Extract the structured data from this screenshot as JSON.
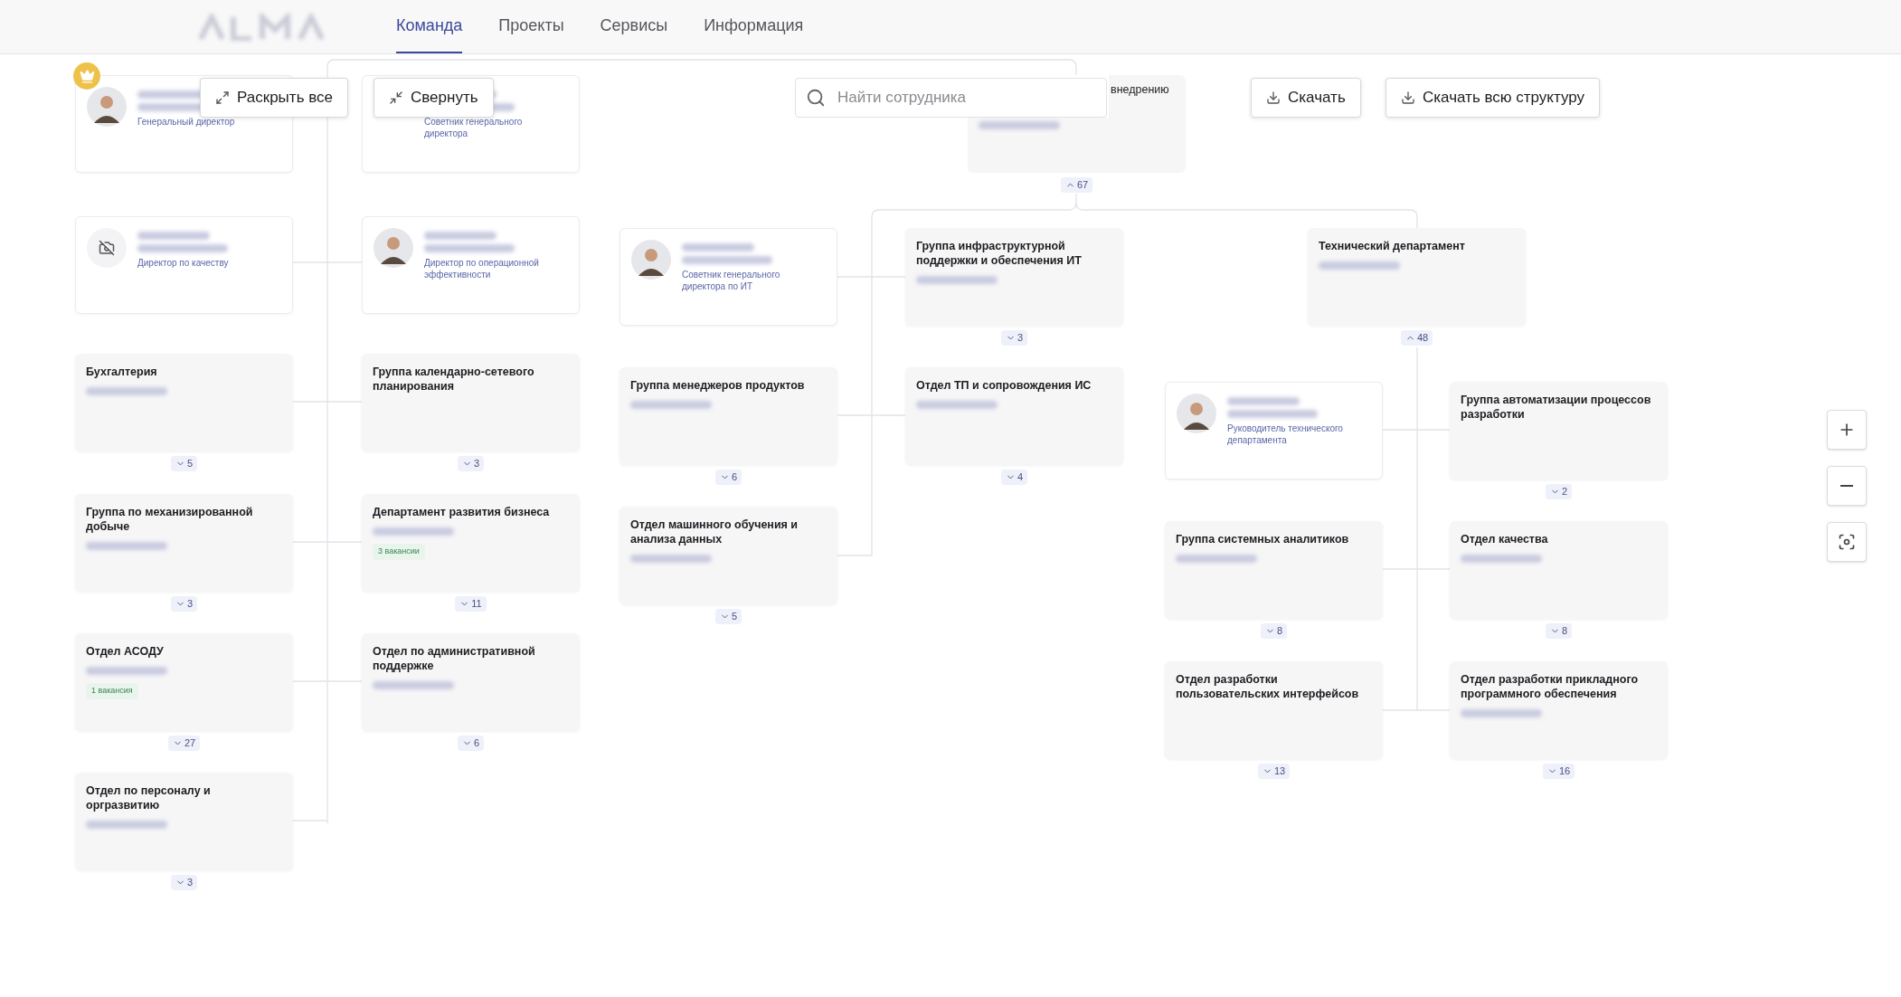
{
  "nav": {
    "tabs": [
      {
        "label": "Команда",
        "selected": true
      },
      {
        "label": "Проекты",
        "selected": false
      },
      {
        "label": "Сервисы",
        "selected": false
      },
      {
        "label": "Информация",
        "selected": false
      }
    ]
  },
  "toolbar": {
    "expand_all": "Раскрыть все",
    "collapse": "Свернуть",
    "search": {
      "placeholder": "Найти сотрудника"
    },
    "download": "Скачать",
    "download_all": "Скачать всю структуру"
  },
  "cards": [
    {
      "kind": "person",
      "role": "Генеральный директор",
      "has_photo": true,
      "crown": true
    },
    {
      "kind": "person",
      "role": "Директор по качеству",
      "has_photo": false,
      "crown": false
    },
    {
      "kind": "department",
      "title": "Бухгалтерия",
      "head_blurred": true,
      "count": "5",
      "expanded": false
    },
    {
      "kind": "department",
      "title": "Группа по механизированной добыче",
      "head_blurred": true,
      "count": "3",
      "expanded": false
    },
    {
      "kind": "department",
      "title": "Отдел АСОДУ",
      "head_blurred": true,
      "vacancy": "1 вакансия",
      "count": "27",
      "expanded": false
    },
    {
      "kind": "department",
      "title": "Отдел по персоналу и оргразвитию",
      "head_blurred": true,
      "count": "3",
      "expanded": false
    },
    {
      "kind": "person",
      "role": "Советник генерального директора",
      "crown": false
    },
    {
      "kind": "person",
      "role": "Директор по операционной эффективности",
      "has_photo": true,
      "crown": false
    },
    {
      "kind": "department",
      "title": "Группа календарно-сетевого планирования",
      "head_blurred": false,
      "count": "3",
      "expanded": false
    },
    {
      "kind": "department",
      "title": "Департамент развития бизнеса",
      "head_blurred": true,
      "vacancy": "3 вакансии",
      "count": "11",
      "expanded": false
    },
    {
      "kind": "department",
      "title": "Отдел по административной поддержке",
      "head_blurred": true,
      "count": "6",
      "expanded": false
    },
    {
      "kind": "partial",
      "title": "внедрению",
      "head_blurred": true,
      "count": "67",
      "expanded": true
    },
    {
      "kind": "person",
      "role": "Советник генерального директора по ИТ",
      "has_photo": true,
      "crown": false
    },
    {
      "kind": "department",
      "title": "Группа менеджеров продуктов",
      "head_blurred": true,
      "count": "6",
      "expanded": false
    },
    {
      "kind": "department",
      "title": "Отдел машинного обучения и анализа данных",
      "head_blurred": true,
      "count": "5",
      "expanded": false
    },
    {
      "kind": "department",
      "title": "Группа инфраструктурной поддержки и обеспечения ИТ",
      "head_blurred": true,
      "count": "3",
      "expanded": false
    },
    {
      "kind": "department",
      "title": "Отдел ТП и сопровождения ИС",
      "head_blurred": true,
      "count": "4",
      "expanded": false
    },
    {
      "kind": "department",
      "title": "Технический департамент",
      "head_blurred": true,
      "count": "48",
      "expanded": true
    },
    {
      "kind": "person",
      "role": "Руководитель технического департамента",
      "has_photo": true,
      "crown": false
    },
    {
      "kind": "department",
      "title": "Группа системных аналитиков",
      "head_blurred": true,
      "count": "8",
      "expanded": false
    },
    {
      "kind": "department",
      "title": "Отдел разработки пользовательских интерфейсов",
      "head_blurred": false,
      "count": "13",
      "expanded": false
    },
    {
      "kind": "department",
      "title": "Группа автоматизации процессов разработки",
      "head_blurred": false,
      "count": "2",
      "expanded": false
    },
    {
      "kind": "department",
      "title": "Отдел качества",
      "head_blurred": true,
      "count": "8",
      "expanded": false
    },
    {
      "kind": "department",
      "title": "Отдел разработки прикладного программного обеспечения",
      "head_blurred": true,
      "count": "16",
      "expanded": false
    }
  ]
}
